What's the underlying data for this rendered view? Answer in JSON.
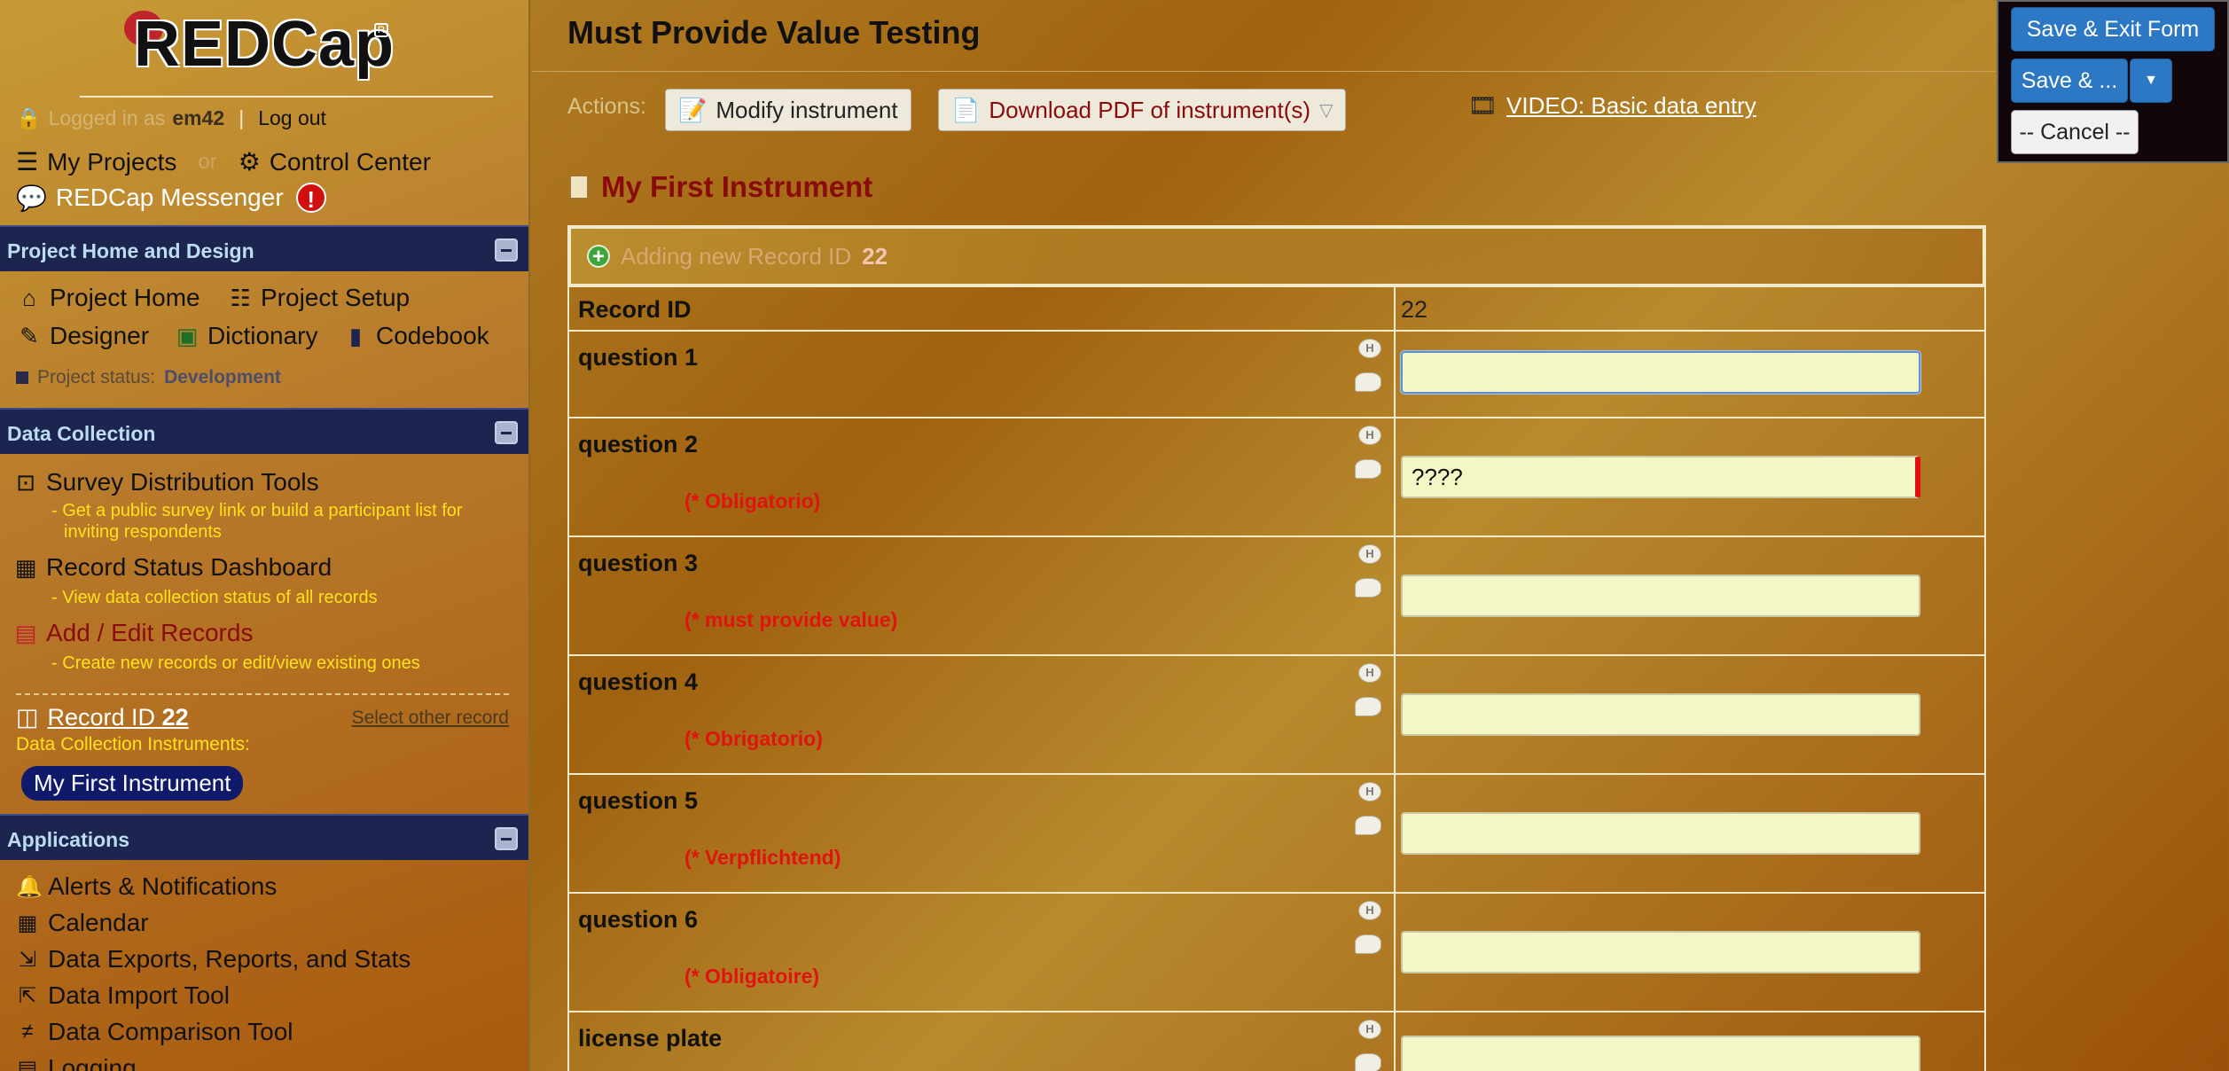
{
  "sidebar": {
    "logo_text": "REDCap",
    "login": {
      "logged_in_as": "Logged in as",
      "username": "em42",
      "logout": "Log out"
    },
    "my_projects": "My Projects",
    "or": "or",
    "control_center": "Control Center",
    "messenger": "REDCap Messenger",
    "messenger_badge": "!",
    "sections": {
      "home": {
        "title": "Project Home and Design",
        "project_home": "Project Home",
        "project_setup": "Project Setup",
        "designer": "Designer",
        "dictionary": "Dictionary",
        "codebook": "Codebook",
        "status_label": "Project status:",
        "status_value": "Development"
      },
      "data_collection": {
        "title": "Data Collection",
        "survey_tools": "Survey Distribution Tools",
        "survey_desc_1": "- Get a public survey link or build a participant list for",
        "survey_desc_2": "inviting respondents",
        "record_status": "Record Status Dashboard",
        "record_status_desc": "- View data collection status of all records",
        "add_edit": "Add / Edit Records",
        "add_edit_desc": "- Create new records or edit/view existing ones",
        "record_id_label": "Record ID",
        "record_id_value": "22",
        "select_other": "Select other record",
        "instruments_label": "Data Collection Instruments:",
        "instrument_pill": "My First Instrument"
      },
      "applications": {
        "title": "Applications",
        "items": [
          "Alerts & Notifications",
          "Calendar",
          "Data Exports, Reports, and Stats",
          "Data Import Tool",
          "Data Comparison Tool",
          "Logging"
        ]
      }
    }
  },
  "main": {
    "page_title": "Must Provide Value Testing",
    "actions_label": "Actions:",
    "modify_instrument": "Modify instrument",
    "download_pdf": "Download PDF of instrument(s)",
    "video_link": "VIDEO: Basic data entry",
    "instrument_title": "My First Instrument",
    "adding_text": "Adding new Record ID",
    "adding_id": "22",
    "record_id_label": "Record ID",
    "record_id_value": "22",
    "questions": [
      {
        "label": "question 1",
        "required": "",
        "value": ""
      },
      {
        "label": "question 2",
        "required": "(* Obligatorio)",
        "value": "????"
      },
      {
        "label": "question 3",
        "required": "(* must provide value)",
        "value": ""
      },
      {
        "label": "question 4",
        "required": "(* Obrigatorio)",
        "value": ""
      },
      {
        "label": "question 5",
        "required": "(* Verpflichtend)",
        "value": ""
      },
      {
        "label": "question 6",
        "required": "(* Obligatoire)",
        "value": ""
      },
      {
        "label": "license plate",
        "required": "",
        "value": ""
      }
    ],
    "history_icon_text": "H"
  },
  "savebox": {
    "save_exit": "Save & Exit Form",
    "save_more": "Save & ...",
    "cancel": "-- Cancel --"
  }
}
